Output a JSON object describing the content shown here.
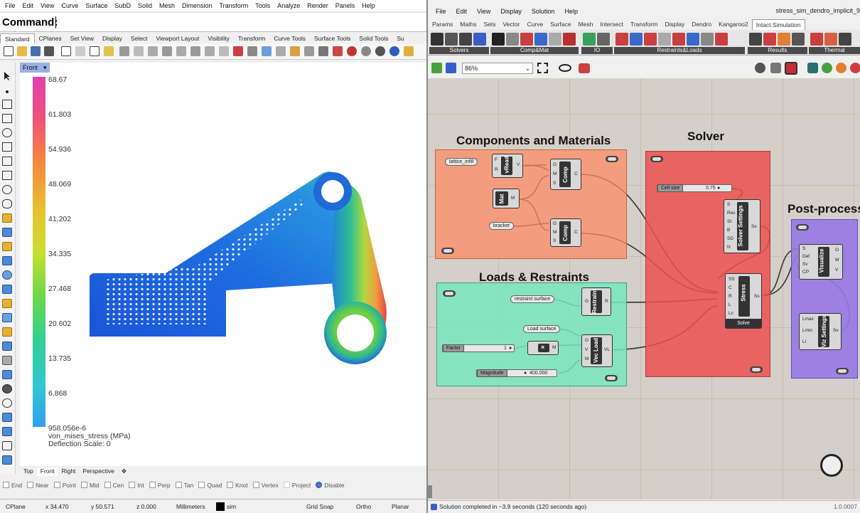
{
  "rhino": {
    "menu": [
      "File",
      "Edit",
      "View",
      "Curve",
      "Surface",
      "SubD",
      "Solid",
      "Mesh",
      "Dimension",
      "Transform",
      "Tools",
      "Analyze",
      "Render",
      "Panels",
      "Help"
    ],
    "command_label": "Command:",
    "toolbar_tabs": [
      "Standard",
      "CPlanes",
      "Set View",
      "Display",
      "Select",
      "Viewport Layout",
      "Visibility",
      "Transform",
      "Curve Tools",
      "Surface Tools",
      "Solid Tools",
      "Su"
    ],
    "active_toolbar_tab": "Standard",
    "viewport_name": "Front",
    "legend": {
      "values": [
        "68.67",
        "61.803",
        "54.936",
        "48.069",
        "41.202",
        "34.335",
        "27.468",
        "20.602",
        "13.735",
        "6.868",
        "958.056e-6"
      ],
      "title": "von_mises_stress (MPa)",
      "deflection": "Deflection Scale: 0"
    },
    "viewport_tabs": [
      "Top",
      "Front",
      "Right",
      "Perspective"
    ],
    "active_viewport_tab": "Front",
    "osnaps": [
      {
        "label": "End",
        "checked": false
      },
      {
        "label": "Near",
        "checked": false
      },
      {
        "label": "Point",
        "checked": false
      },
      {
        "label": "Mid",
        "checked": false
      },
      {
        "label": "Cen",
        "checked": false
      },
      {
        "label": "Int",
        "checked": false
      },
      {
        "label": "Perp",
        "checked": false
      },
      {
        "label": "Tan",
        "checked": false
      },
      {
        "label": "Quad",
        "checked": false
      },
      {
        "label": "Knot",
        "checked": false
      },
      {
        "label": "Vertex",
        "checked": false
      },
      {
        "label": "Project",
        "checked": false
      },
      {
        "label": "Disable",
        "checked": true
      }
    ],
    "status": {
      "cplane": "CPlane",
      "x": "x 34.470",
      "y": "y 50.571",
      "z": "z 0.000",
      "units": "Millimeters",
      "layer": "sim",
      "grid_snap": "Grid Snap",
      "ortho": "Ortho",
      "planar": "Planar"
    }
  },
  "gh": {
    "menu": [
      "File",
      "Edit",
      "View",
      "Display",
      "Solution",
      "Help"
    ],
    "title": "stress_sim_dendro_implicit_9",
    "tabs": [
      "Params",
      "Maths",
      "Sets",
      "Vector",
      "Curve",
      "Surface",
      "Mesh",
      "Intersect",
      "Transform",
      "Display",
      "Dendro",
      "Kangaroo2",
      "Intact.Simulation"
    ],
    "active_tab": "Intact.Simulation",
    "ribbon_groups": [
      "Solvers",
      "Comp&Mat",
      "IO",
      "Restraints&Loads",
      "Results",
      "Thermal"
    ],
    "zoom": "86%",
    "groups": {
      "components": "Components and Materials",
      "solver": "Solver",
      "postprocess": "Post-process",
      "loads": "Loads & Restraints"
    },
    "params": {
      "lattice": "lattice_infill",
      "bracket": "bracket",
      "restraint": "restraint surface",
      "load_surface": "Load surface"
    },
    "components": {
      "vread": "vRead",
      "mat": "Mat",
      "comp1": "Comp",
      "comp2": "Comp",
      "solver_settings": "Solver Settings",
      "stress": "Stress",
      "solve": "Solve",
      "visualize": "Visualize",
      "viz_settings": "Viz Settings",
      "restraint": "Restraint",
      "vec_load": "Vec Load",
      "mult": "×"
    },
    "sliders": {
      "cell_size": {
        "label": "Cell size",
        "value": "0.75"
      },
      "factor": {
        "label": "Factor",
        "value": "1"
      },
      "magnitude": {
        "label": "Magnitude",
        "value": "400.000"
      }
    },
    "ports": {
      "vread_in": [
        "F",
        "R"
      ],
      "vread_out": [
        "V"
      ],
      "mat_out": [
        "M"
      ],
      "comp_in": [
        "G",
        "M",
        "S"
      ],
      "comp_out": [
        "C"
      ],
      "solver_in": [
        "S",
        "Res",
        "St",
        "B",
        "SD",
        "N"
      ],
      "solver_out": [
        "Ss"
      ],
      "stress_in": [
        "SS",
        "C",
        "R",
        "L",
        "Lc"
      ],
      "stress_out": [
        "Ss"
      ],
      "vis_in": [
        "S",
        "Def",
        "Sv",
        "CP"
      ],
      "vis_out": [
        "O",
        "M",
        "V"
      ],
      "vizset_in": [
        "Lmax",
        "Lmin",
        "Li"
      ],
      "vizset_out": [
        "Sv"
      ],
      "restraint_in": [
        "G"
      ],
      "restraint_out": [
        "R"
      ],
      "vec_in": [
        "G",
        "V",
        "M"
      ],
      "vec_out": [
        "VL"
      ],
      "mult_out": [
        "M"
      ]
    },
    "status": "Solution completed in ~3.9 seconds (120 seconds ago)",
    "version": "1.0.0007"
  }
}
